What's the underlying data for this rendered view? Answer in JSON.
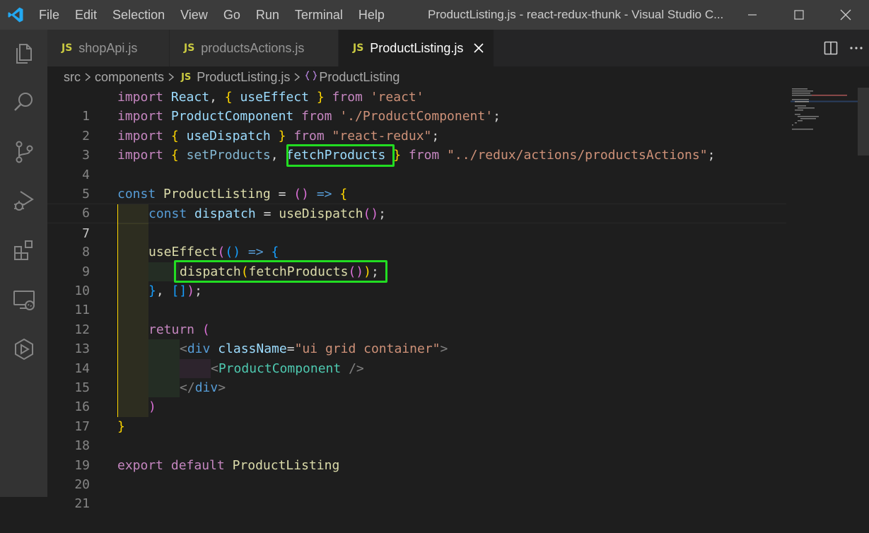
{
  "menu": [
    "File",
    "Edit",
    "Selection",
    "View",
    "Go",
    "Run",
    "Terminal",
    "Help"
  ],
  "window_title": "ProductListing.js - react-redux-thunk - Visual Studio C...",
  "tabs": [
    {
      "badge": "JS",
      "label": "shopApi.js"
    },
    {
      "badge": "JS",
      "label": "productsActions.js"
    },
    {
      "badge": "JS",
      "label": "ProductListing.js"
    }
  ],
  "breadcrumb": {
    "src": "src",
    "components": "components",
    "badge": "JS",
    "file": "ProductListing.js",
    "symbol": "ProductListing"
  },
  "line_numbers": [
    "1",
    "2",
    "3",
    "4",
    "5",
    "6",
    "7",
    "8",
    "9",
    "10",
    "11",
    "12",
    "13",
    "14",
    "15",
    "16",
    "17",
    "18",
    "19",
    "20",
    "21"
  ],
  "code": {
    "l1": [
      "import",
      "React",
      ",",
      "{",
      "useEffect",
      "}",
      "from",
      "'react'"
    ],
    "l2": [
      "import",
      "ProductComponent",
      "from",
      "'./ProductComponent'",
      ";"
    ],
    "l3": [
      "import",
      "{",
      "useDispatch",
      "}",
      "from",
      "\"react-redux\"",
      ";"
    ],
    "l4": [
      "import",
      "{",
      "setProducts",
      ",",
      "fetchProducts",
      "}",
      "from",
      "\"../redux/actions/productsActions\"",
      ";"
    ],
    "l6": [
      "const",
      "ProductListing",
      "=",
      "()",
      "=>",
      "{"
    ],
    "l7": [
      "const",
      "dispatch",
      "=",
      "useDispatch",
      "()",
      ";"
    ],
    "l9": [
      "useEffect",
      "(",
      "()",
      "=>",
      "{"
    ],
    "l10": [
      "dispatch",
      "(",
      "fetchProducts",
      "()",
      ")",
      ";"
    ],
    "l11": [
      "}",
      ",",
      "[]",
      ")",
      ";"
    ],
    "l13": [
      "return",
      "("
    ],
    "l14": [
      "<",
      "div",
      "className",
      "=",
      "\"ui grid container\"",
      ">"
    ],
    "l15": [
      "<",
      "ProductComponent",
      "/>"
    ],
    "l16": [
      "</",
      "div",
      ">"
    ],
    "l17": [
      ")"
    ],
    "l18": [
      "}"
    ],
    "l20": [
      "export",
      "default",
      "ProductListing"
    ]
  },
  "colors": {
    "highlight_box": "#22dd22",
    "accent": "#007acc"
  }
}
